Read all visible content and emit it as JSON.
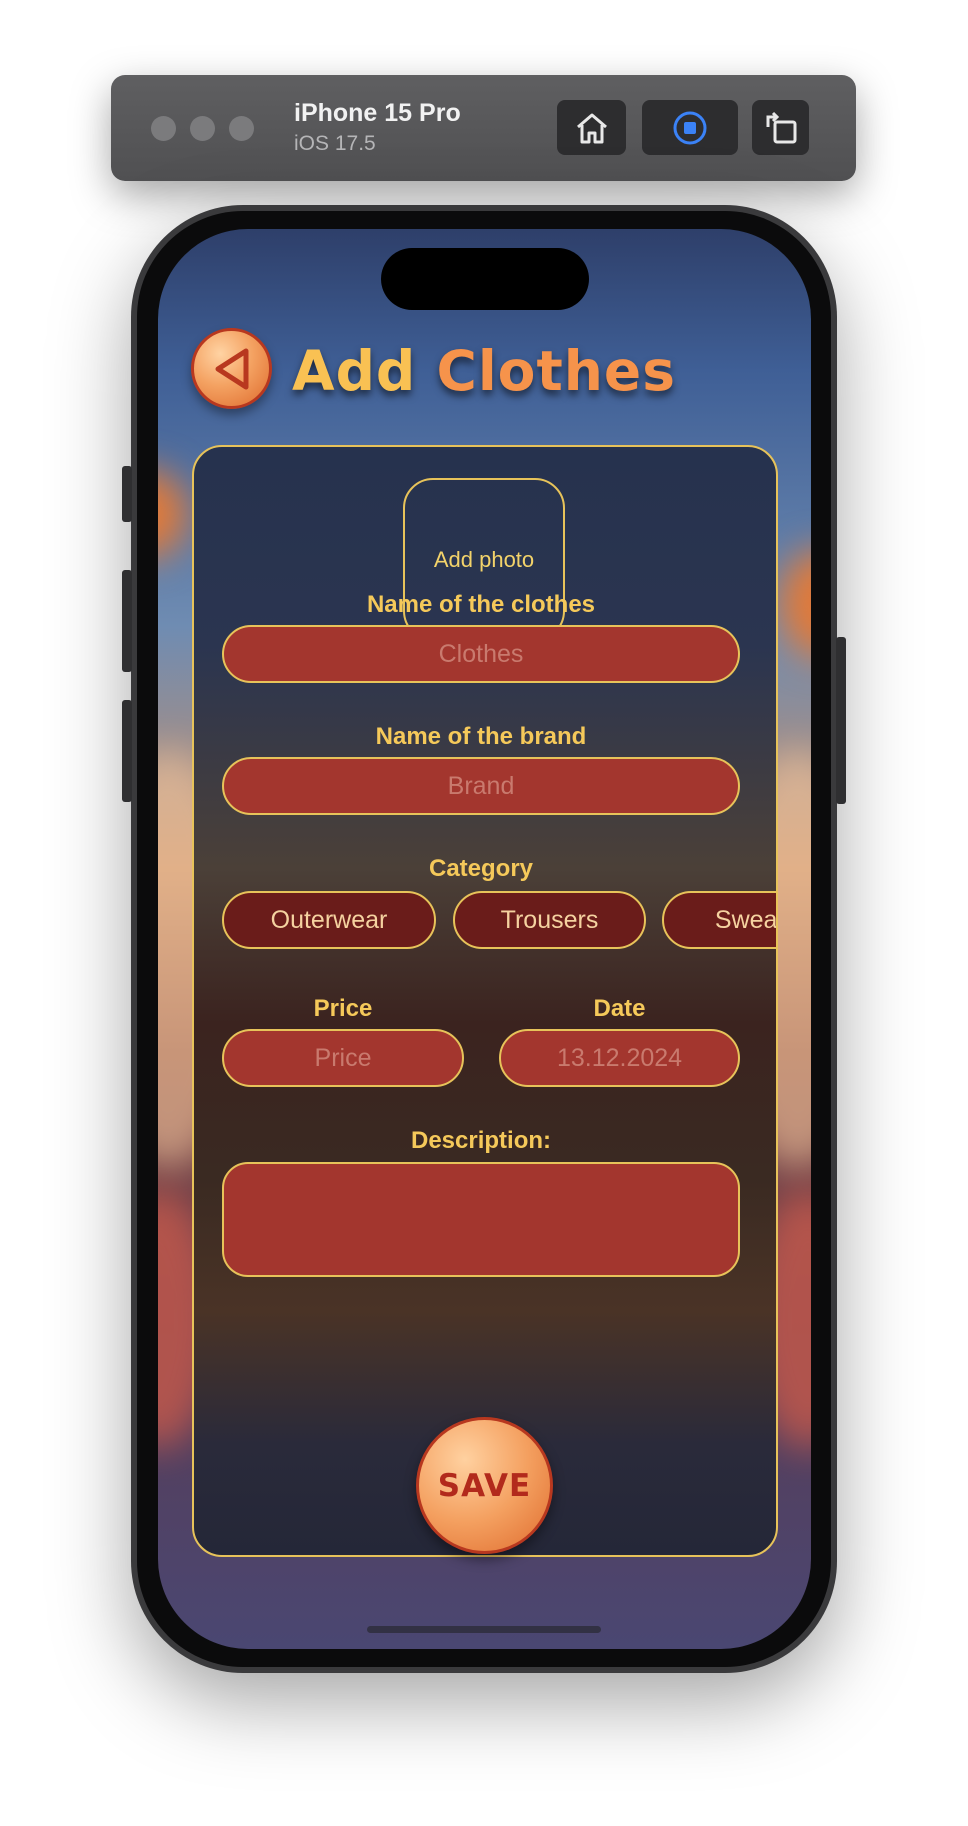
{
  "simulator": {
    "device_name": "iPhone 15 Pro",
    "os_version": "iOS 17.5",
    "buttons": [
      {
        "icon": "home-icon"
      },
      {
        "icon": "record-icon",
        "accent": "#3b82f6"
      },
      {
        "icon": "rotate-icon"
      }
    ]
  },
  "header": {
    "back_icon": "back-triangle-icon",
    "title_part1": "Add",
    "title_part2": "Clothes"
  },
  "form": {
    "photo_label": "Add photo",
    "clothes_name": {
      "label": "Name of the clothes",
      "placeholder": "Clothes",
      "value": ""
    },
    "brand_name": {
      "label": "Name of the brand",
      "placeholder": "Brand",
      "value": ""
    },
    "category": {
      "label": "Category",
      "options": [
        "Outerwear",
        "Trousers",
        "Sweaters"
      ]
    },
    "price": {
      "label": "Price",
      "placeholder": "Price",
      "value": ""
    },
    "date": {
      "label": "Date",
      "placeholder": "13.12.2024",
      "value": ""
    },
    "description": {
      "label": "Description:",
      "value": ""
    },
    "save_label": "SAVE"
  },
  "colors": {
    "accent_gold": "#e7c35a",
    "field_red": "#a3362e",
    "title_yellow": "#f9c153",
    "title_orange": "#f6934b"
  }
}
